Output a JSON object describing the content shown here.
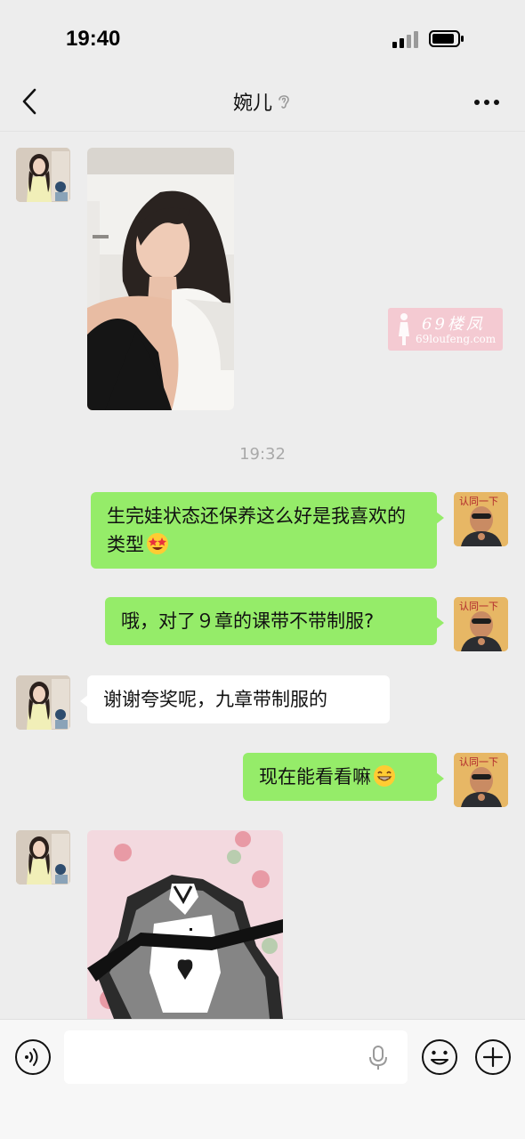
{
  "status_bar": {
    "time": "19:40",
    "signal_icon": "cellular-signal-icon",
    "battery_icon": "battery-icon"
  },
  "nav": {
    "back_icon": "chevron-left-icon",
    "title": "婉儿",
    "title_icon": "ear-icon",
    "more_icon": "more-dots-icon"
  },
  "chat": {
    "timestamp": "19:32",
    "messages": [
      {
        "from": "contact",
        "type": "image",
        "description_icon": "selfie-photo"
      },
      {
        "from": "me",
        "type": "text",
        "text": "生完娃状态还保养这么好是我喜欢的类型",
        "emoji": "star-struck-emoji"
      },
      {
        "from": "me",
        "type": "text",
        "text": "哦，对了９章的课带不带制服?"
      },
      {
        "from": "contact",
        "type": "text",
        "text": "谢谢夸奖呢，九章带制服的"
      },
      {
        "from": "me",
        "type": "text",
        "text": "现在能看看嘛",
        "emoji": "grinning-emoji"
      },
      {
        "from": "contact",
        "type": "image",
        "description_icon": "maid-uniform-photo"
      }
    ]
  },
  "watermark": {
    "main": "69楼凤",
    "sub": "69loufeng.com"
  },
  "input_bar": {
    "voice_icon": "voice-icon",
    "placeholder": "",
    "mic_icon": "microphone-icon",
    "emoji_icon": "smiley-icon",
    "plus_icon": "plus-icon"
  },
  "colors": {
    "background": "#ededed",
    "green_bubble": "#95ec69",
    "white_bubble": "#ffffff",
    "timestamp": "#a9a9a9"
  }
}
